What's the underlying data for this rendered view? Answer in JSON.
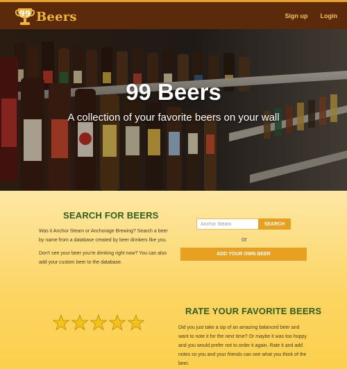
{
  "header": {
    "logo_number": "99",
    "logo_text": "Beers",
    "nav": [
      {
        "label": "Sign up"
      },
      {
        "label": "Login"
      }
    ]
  },
  "hero": {
    "title": "99 Beers",
    "subtitle": "A collection of your favorite beers on your wall"
  },
  "search_section": {
    "title": "SEARCH FOR BEERS",
    "paragraph1": "Was it Anchor Steam or Anchorage Brewing? Search a beer by name from a database created by beer drinkers like you.",
    "paragraph2": "Don't see your beer you're drinking right now? You can also add your custom beer to the database.",
    "search_placeholder": "Anchor Steam",
    "search_button": "SEARCH",
    "or_text": "or",
    "add_button": "ADD YOUR OWN BEER"
  },
  "rate_section": {
    "title": "RATE YOUR FAVORITE BEERS",
    "paragraph": "Did you just take a sip of an amazing balanced beer and want to note it for the next time? Or maybe it was too hoppy and you would prefer not to order it again. Rate it and add notes so you and your friends can see what you think of the beer.",
    "star_rating": 5,
    "star_max": 5
  },
  "colors": {
    "header_bg": "#5a2a0a",
    "accent": "#e8a020",
    "title_green": "#2e5d1f",
    "star": "#f3c318"
  }
}
